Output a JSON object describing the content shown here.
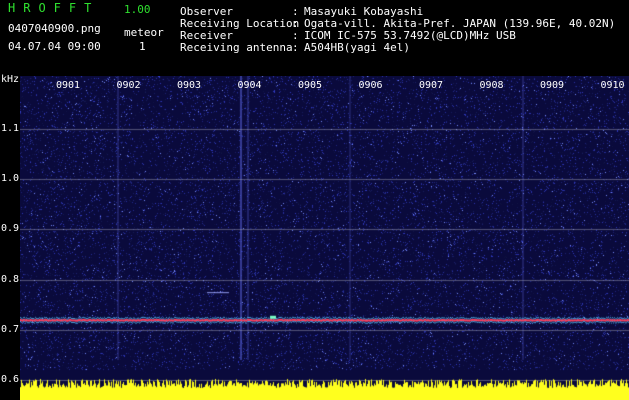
{
  "app": {
    "name": "HROFFT",
    "version": "1.00"
  },
  "file": {
    "name": "0407040900.png",
    "datetime": "04.07.04 09:00"
  },
  "meteor": {
    "label": "meteor",
    "count": "1"
  },
  "station": [
    {
      "label": "Observer",
      "value": "Masayuki Kobayashi"
    },
    {
      "label": "Receiving Location",
      "value": "Ogata-vill. Akita-Pref. JAPAN (139.96E, 40.02N)"
    },
    {
      "label": "Receiver",
      "value": "ICOM IC-575 53.7492(@LCD)MHz USB"
    },
    {
      "label": "Receiving antenna",
      "value": "A504HB(yagi 4el)"
    }
  ],
  "axis": {
    "unit": "kHz",
    "time_ticks": [
      "0901",
      "0902",
      "0903",
      "0904",
      "0905",
      "0906",
      "0907",
      "0908",
      "0909",
      "0910"
    ],
    "freq_ticks": [
      "1.1",
      "1.0",
      "0.9",
      "0.8",
      "0.7",
      "0.6"
    ]
  },
  "colors": {
    "accent": "#2fe02f",
    "background": "#000000",
    "spectrum": "#0a0a3c",
    "trace": "#ff4060",
    "level": "#ffff1e"
  },
  "chart_data": {
    "type": "heatmap",
    "x": [
      "0901",
      "0902",
      "0903",
      "0904",
      "0905",
      "0906",
      "0907",
      "0908",
      "0909",
      "0910"
    ],
    "y_unit": "kHz",
    "ylim": [
      0.6,
      1.15
    ],
    "y_ticks": [
      0.6,
      0.7,
      0.8,
      0.9,
      1.0,
      1.1
    ],
    "carrier_frequency_khz": 0.72
  }
}
